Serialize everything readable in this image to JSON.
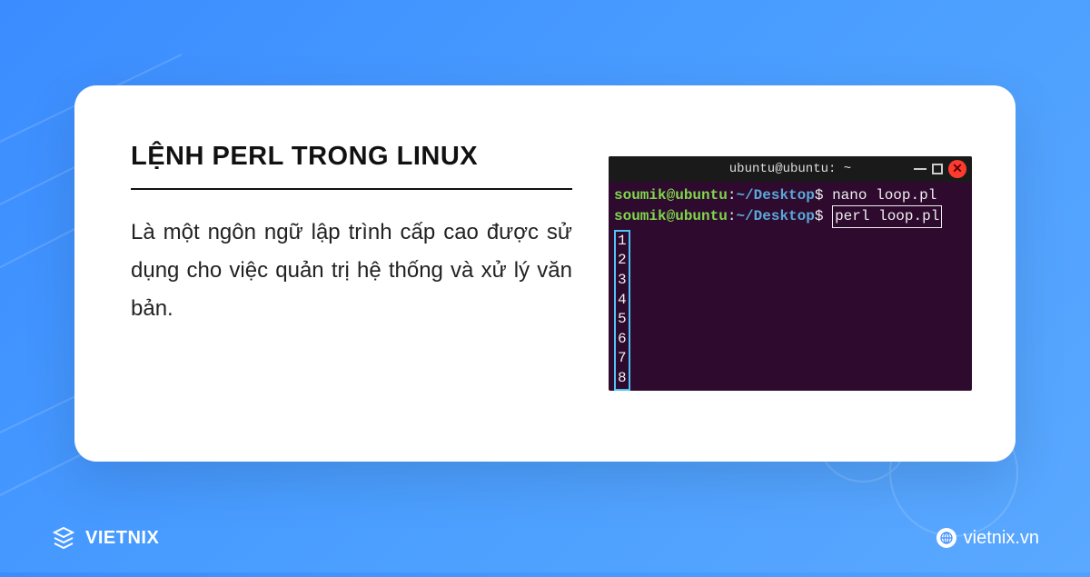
{
  "card": {
    "heading": "LỆNH  PERL TRONG LINUX",
    "description": "Là một ngôn ngữ lập trình cấp cao được sử dụng cho việc quản trị hệ thống và xử lý văn bản."
  },
  "terminal": {
    "title": "ubuntu@ubuntu: ~",
    "lines": [
      {
        "user": "soumik@ubuntu",
        "colon": ":",
        "path": "~/Desktop",
        "prompt": "$",
        "cmd": "nano loop.pl",
        "boxed": false
      },
      {
        "user": "soumik@ubuntu",
        "colon": ":",
        "path": "~/Desktop",
        "prompt": "$",
        "cmd": "perl loop.pl",
        "boxed": true
      }
    ],
    "output": [
      "1",
      "2",
      "3",
      "4",
      "5",
      "6",
      "7",
      "8"
    ],
    "close_glyph": "✕"
  },
  "footer": {
    "brand": "VIETNIX",
    "site": "vietnix.vn"
  }
}
